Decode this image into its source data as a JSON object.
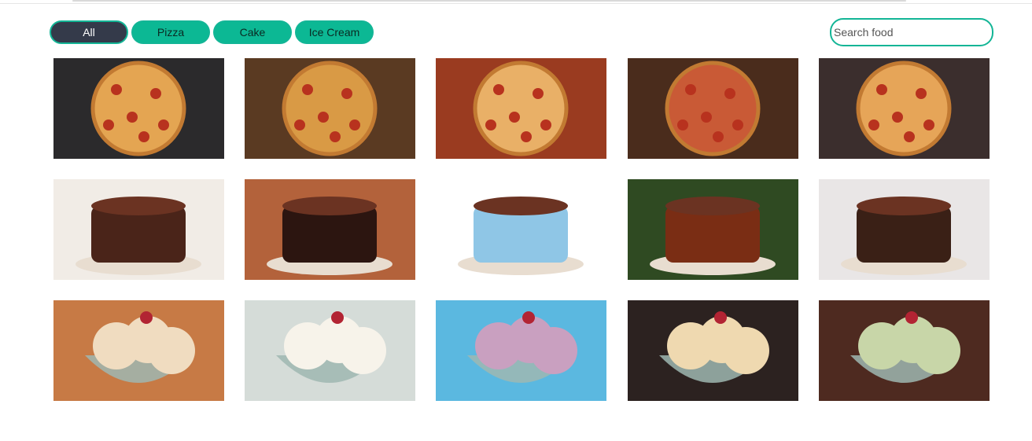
{
  "filters": [
    {
      "label": "All",
      "active": true
    },
    {
      "label": "Pizza",
      "active": false
    },
    {
      "label": "Cake",
      "active": false
    },
    {
      "label": "Ice Cream",
      "active": false
    }
  ],
  "search": {
    "placeholder": "Search food",
    "value": ""
  },
  "colors": {
    "accent": "#13b596",
    "active_chip": "#343a4a"
  },
  "gallery": {
    "rows": [
      {
        "category": "Pizza",
        "items": [
          {
            "name": "pizza-photo-1",
            "bg": "#2b2a2c",
            "food": "#e4a552"
          },
          {
            "name": "pizza-photo-2",
            "bg": "#5a3a22",
            "food": "#d99a45"
          },
          {
            "name": "pizza-photo-3",
            "bg": "#9a3b20",
            "food": "#e9b067"
          },
          {
            "name": "pizza-photo-4",
            "bg": "#4a2c1c",
            "food": "#c95a36"
          },
          {
            "name": "pizza-photo-5",
            "bg": "#3b2e2d",
            "food": "#e6a558"
          }
        ]
      },
      {
        "category": "Cake",
        "items": [
          {
            "name": "cake-photo-1",
            "bg": "#f1ece6",
            "food": "#4a2419"
          },
          {
            "name": "cake-photo-2",
            "bg": "#b3623b",
            "food": "#2c1510"
          },
          {
            "name": "cake-photo-3",
            "bg": "#ffffff",
            "food": "#8fc6e6"
          },
          {
            "name": "cake-photo-4",
            "bg": "#2f4a22",
            "food": "#7a2d14"
          },
          {
            "name": "cake-photo-5",
            "bg": "#e9e6e6",
            "food": "#3a2016"
          }
        ]
      },
      {
        "category": "Ice Cream",
        "items": [
          {
            "name": "icecream-photo-1",
            "bg": "#c77a45",
            "food": "#f0dcc0"
          },
          {
            "name": "icecream-photo-2",
            "bg": "#d5dcd8",
            "food": "#f7f3ea"
          },
          {
            "name": "icecream-photo-3",
            "bg": "#5bb8e0",
            "food": "#c9a0c0"
          },
          {
            "name": "icecream-photo-4",
            "bg": "#2c2220",
            "food": "#efd9b0"
          },
          {
            "name": "icecream-photo-5",
            "bg": "#4e2a20",
            "food": "#c8d6a8"
          }
        ]
      }
    ]
  }
}
